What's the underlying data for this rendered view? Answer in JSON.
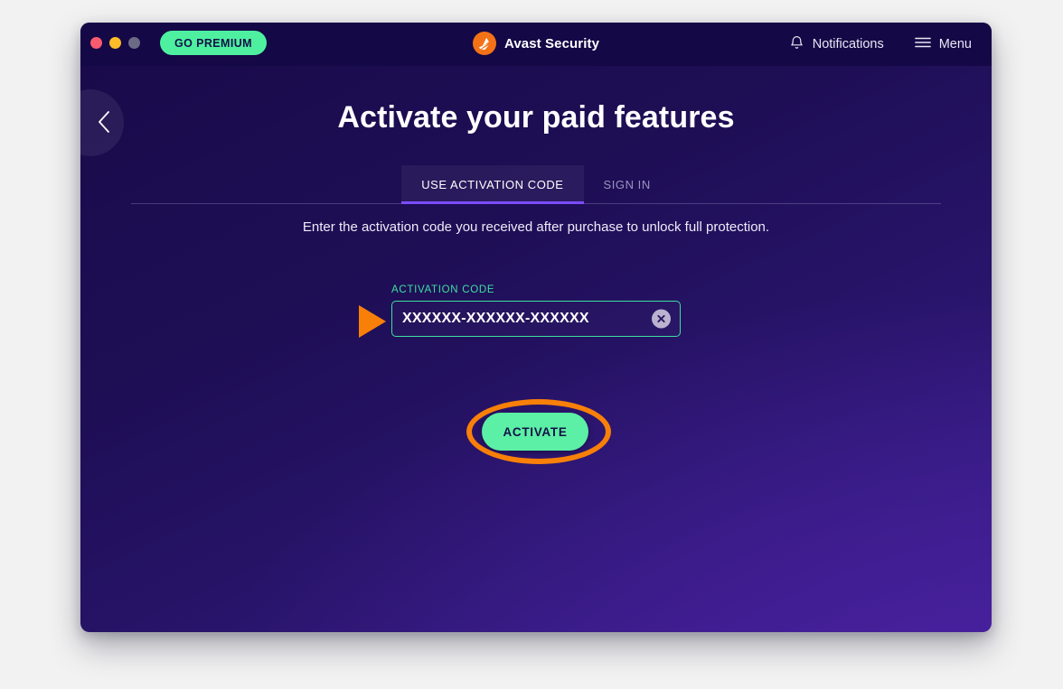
{
  "window": {
    "traffic_lights": [
      {
        "name": "close",
        "color": "#f95b6e"
      },
      {
        "name": "minimize",
        "color": "#fdbc28"
      },
      {
        "name": "zoom",
        "color": "#6b6b86"
      }
    ]
  },
  "header": {
    "go_premium_label": "GO PREMIUM",
    "brand_name": "Avast Security",
    "brand_logo_icon": "avast-logo-icon",
    "notifications_label": "Notifications",
    "notifications_icon": "bell-icon",
    "menu_label": "Menu",
    "menu_icon": "hamburger-menu-icon"
  },
  "nav": {
    "back_icon": "chevron-left-icon"
  },
  "main": {
    "title": "Activate your paid features",
    "subtitle": "Enter the activation code you received after purchase to unlock full protection.",
    "tabs": [
      {
        "label": "USE ACTIVATION CODE",
        "active": true
      },
      {
        "label": "SIGN IN",
        "active": false
      }
    ],
    "activation": {
      "label": "ACTIVATION CODE",
      "value": "XXXXXX-XXXXXX-XXXXXX",
      "placeholder": "XXXXXX-XXXXXX-XXXXXX",
      "clear_icon": "clear-circle-x-icon"
    },
    "activate_button_label": "ACTIVATE"
  },
  "annotations": {
    "arrow_color": "#f98008",
    "ellipse_color": "#f98008",
    "arrow_target": "activation-code-input",
    "ellipse_target": "activate-button"
  },
  "colors": {
    "accent_green": "#4ef0a0",
    "tab_underline": "#7b4dff",
    "brand_orange": "#f47216",
    "window_dark": "#140846"
  }
}
